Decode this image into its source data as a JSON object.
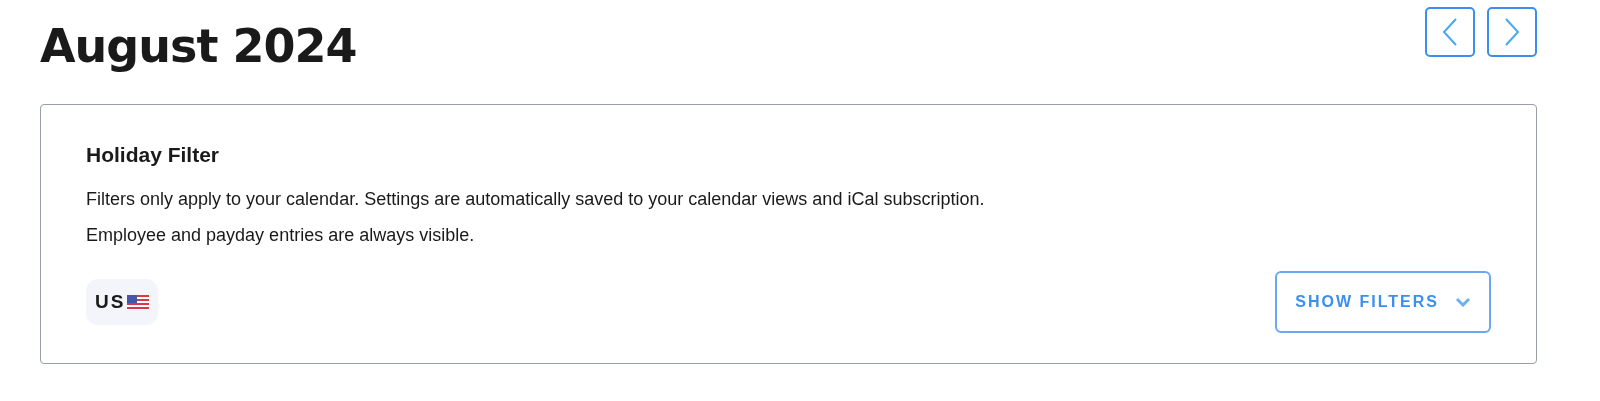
{
  "header": {
    "title": "August 2024"
  },
  "holiday_filter": {
    "title": "Holiday Filter",
    "description": [
      "Filters only apply to your calendar. Settings are automatically saved to your calendar views and iCal subscription.",
      "Employee and payday entries are always visible."
    ],
    "chips": [
      {
        "label": "US"
      }
    ],
    "show_filters_button": {
      "label": "SHOW FILTERS",
      "expanded": false
    }
  }
}
